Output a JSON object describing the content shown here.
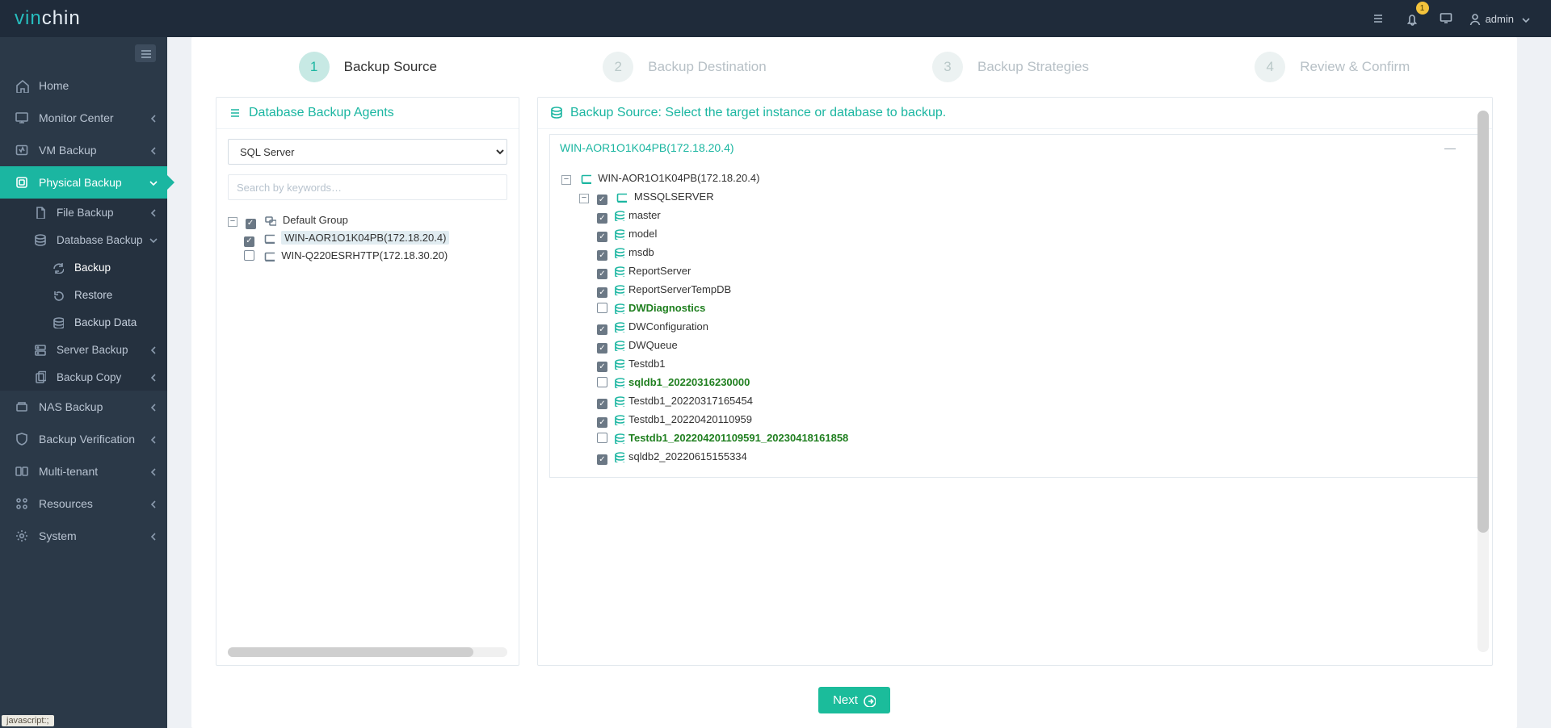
{
  "brand": {
    "accent": "vin",
    "rest": "chin"
  },
  "topbar": {
    "notif_count": "1",
    "user": "admin"
  },
  "sidebar": {
    "home": "Home",
    "monitor": "Monitor Center",
    "vm": "VM Backup",
    "physical": "Physical Backup",
    "file_backup": "File Backup",
    "db_backup": "Database Backup",
    "backup": "Backup",
    "restore": "Restore",
    "backup_data": "Backup Data",
    "server_backup": "Server Backup",
    "backup_copy": "Backup Copy",
    "nas": "NAS Backup",
    "verify": "Backup Verification",
    "multit": "Multi-tenant",
    "resources": "Resources",
    "system": "System"
  },
  "wizard": {
    "s1": "Backup Source",
    "s2": "Backup Destination",
    "s3": "Backup Strategies",
    "s4": "Review & Confirm"
  },
  "left_panel": {
    "title": "Database Backup Agents",
    "db_type": "SQL Server",
    "search_ph": "Search by keywords…",
    "group": "Default Group",
    "host1": "WIN-AOR1O1K04PB(172.18.20.4)",
    "host2": "WIN-Q220ESRH7TP(172.18.30.20)"
  },
  "right_panel": {
    "title": "Backup Source: Select the target instance or database to backup.",
    "host_title": "WIN-AOR1O1K04PB(172.18.20.4)",
    "host_label": "WIN-AOR1O1K04PB(172.18.20.4)",
    "instance": "MSSQLSERVER",
    "dbs": [
      {
        "name": "master",
        "checked": true,
        "offline": false
      },
      {
        "name": "model",
        "checked": true,
        "offline": false
      },
      {
        "name": "msdb",
        "checked": true,
        "offline": false
      },
      {
        "name": "ReportServer",
        "checked": true,
        "offline": false
      },
      {
        "name": "ReportServerTempDB",
        "checked": true,
        "offline": false
      },
      {
        "name": "DWDiagnostics",
        "checked": false,
        "offline": true
      },
      {
        "name": "DWConfiguration",
        "checked": true,
        "offline": false
      },
      {
        "name": "DWQueue",
        "checked": true,
        "offline": false
      },
      {
        "name": "Testdb1",
        "checked": true,
        "offline": false
      },
      {
        "name": "sqldb1_20220316230000",
        "checked": false,
        "offline": true
      },
      {
        "name": "Testdb1_20220317165454",
        "checked": true,
        "offline": false
      },
      {
        "name": "Testdb1_20220420110959",
        "checked": true,
        "offline": false
      },
      {
        "name": "Testdb1_202204201109591_20230418161858",
        "checked": false,
        "offline": true
      },
      {
        "name": "sqldb2_20220615155334",
        "checked": true,
        "offline": false
      }
    ]
  },
  "footer": {
    "next": "Next"
  },
  "status": "javascript:;"
}
